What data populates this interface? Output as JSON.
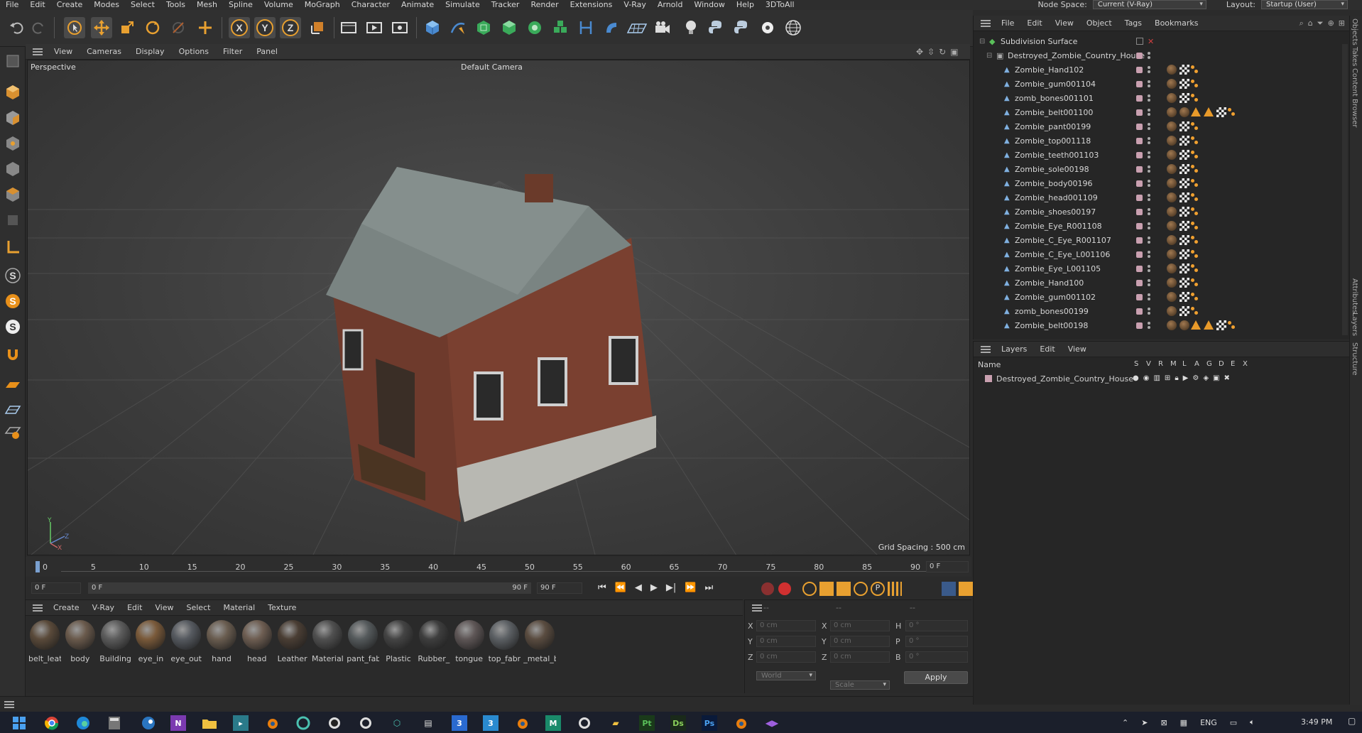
{
  "menubar": {
    "items": [
      "File",
      "Edit",
      "Create",
      "Modes",
      "Select",
      "Tools",
      "Mesh",
      "Spline",
      "Volume",
      "MoGraph",
      "Character",
      "Animate",
      "Simulate",
      "Tracker",
      "Render",
      "Extensions",
      "V-Ray",
      "Arnold",
      "Window",
      "Help",
      "3DToAll"
    ],
    "node_space_label": "Node Space:",
    "node_space_value": "Current (V-Ray)",
    "layout_label": "Layout:",
    "layout_value": "Startup (User)"
  },
  "toolbar": {
    "axis_x": "X",
    "axis_y": "Y",
    "axis_z": "Z"
  },
  "viewport": {
    "menu": [
      "View",
      "Cameras",
      "Display",
      "Options",
      "Filter",
      "Panel"
    ],
    "projection": "Perspective",
    "camera": "Default Camera",
    "grid_spacing": "Grid Spacing : 500 cm",
    "axis_y": "Y",
    "axis_z": "Z",
    "axis_x": "X"
  },
  "timeline": {
    "ticks": [
      "0",
      "5",
      "10",
      "15",
      "20",
      "25",
      "30",
      "35",
      "40",
      "45",
      "50",
      "55",
      "60",
      "65",
      "70",
      "75",
      "80",
      "85",
      "90"
    ],
    "current_frame_right": "0 F",
    "start_frame": "0 F",
    "range_start": "0 F",
    "range_end": "90 F",
    "end_frame": "90 F"
  },
  "materials": {
    "menu": [
      "Create",
      "V-Ray",
      "Edit",
      "View",
      "Select",
      "Material",
      "Texture"
    ],
    "items": [
      {
        "label": "belt_leat",
        "color": "#5a4a3a"
      },
      {
        "label": "body",
        "color": "#6a5a4c"
      },
      {
        "label": "Building",
        "color": "#5c5c5c"
      },
      {
        "label": "eye_in",
        "color": "#7a5a3a"
      },
      {
        "label": "eye_out",
        "color": "#565a60"
      },
      {
        "label": "hand",
        "color": "#6a5d50"
      },
      {
        "label": "head",
        "color": "#6e5e52"
      },
      {
        "label": "Leather",
        "color": "#4a3e34"
      },
      {
        "label": "Material",
        "color": "#505050"
      },
      {
        "label": "pant_fab",
        "color": "#555a5c"
      },
      {
        "label": "Plastic",
        "color": "#444"
      },
      {
        "label": "Rubber_",
        "color": "#3e3e3e"
      },
      {
        "label": "tongue",
        "color": "#5e5656"
      },
      {
        "label": "top_fabr",
        "color": "#5c6064"
      },
      {
        "label": "_metal_b",
        "color": "#5a4c40"
      }
    ]
  },
  "coords": {
    "x_label": "X",
    "y_label": "Y",
    "z_label": "Z",
    "x2_label": "X",
    "y2_label": "Y",
    "z2_label": "Z",
    "h_label": "H",
    "p_label": "P",
    "b_label": "B",
    "pos_value": "0 cm",
    "rot_value": "0 °",
    "col1_header": "--",
    "col2_header": "--",
    "col3_header": "--",
    "space": "World",
    "mode": "Scale",
    "apply": "Apply"
  },
  "objects": {
    "menu": [
      "File",
      "Edit",
      "View",
      "Object",
      "Tags",
      "Bookmarks"
    ],
    "root": "Subdivision Surface",
    "group": "Destroyed_Zombie_Country_House",
    "rows": [
      {
        "name": "Zombie_Hand102",
        "extra": false
      },
      {
        "name": "Zombie_gum001104",
        "extra": false
      },
      {
        "name": "zomb_bones001101",
        "extra": false
      },
      {
        "name": "Zombie_belt001100",
        "extra": true
      },
      {
        "name": "Zombie_pant00199",
        "extra": false
      },
      {
        "name": "Zombie_top001118",
        "extra": false
      },
      {
        "name": "Zombie_teeth001103",
        "extra": false
      },
      {
        "name": "Zombie_sole00198",
        "extra": false
      },
      {
        "name": "Zombie_body00196",
        "extra": false
      },
      {
        "name": "Zombie_head001109",
        "extra": false
      },
      {
        "name": "Zombie_shoes00197",
        "extra": false
      },
      {
        "name": "Zombie_Eye_R001108",
        "extra": false
      },
      {
        "name": "Zombie_C_Eye_R001107",
        "extra": false
      },
      {
        "name": "Zombie_C_Eye_L001106",
        "extra": false
      },
      {
        "name": "Zombie_Eye_L001105",
        "extra": false
      },
      {
        "name": "Zombie_Hand100",
        "extra": false
      },
      {
        "name": "Zombie_gum001102",
        "extra": false
      },
      {
        "name": "zomb_bones00199",
        "extra": false
      },
      {
        "name": "Zombie_belt00198",
        "extra": true
      }
    ]
  },
  "layers": {
    "menu": [
      "Layers",
      "Edit",
      "View"
    ],
    "col_name": "Name",
    "cols": [
      "S",
      "V",
      "R",
      "M",
      "L",
      "A",
      "G",
      "D",
      "E",
      "X"
    ],
    "row_name": "Destroyed_Zombie_Country_House"
  },
  "right_tabs": [
    "Objects",
    "Takes",
    "Content Browser",
    "Attributes",
    "Layers",
    "Structure"
  ],
  "taskbar": {
    "lang": "ENG",
    "time": "3:49 PM"
  }
}
